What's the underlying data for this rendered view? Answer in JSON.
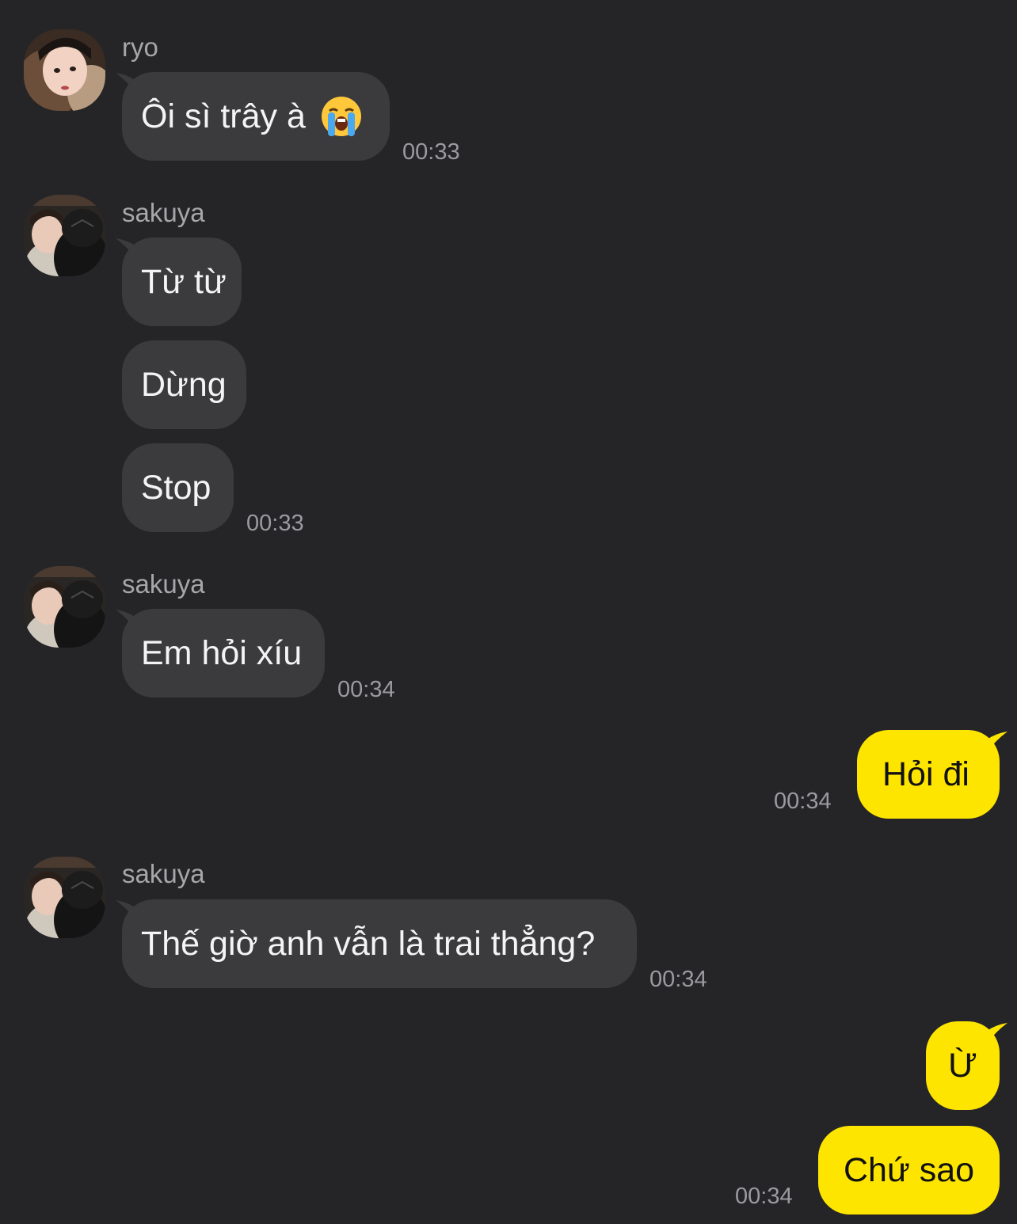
{
  "colors": {
    "background": "#252528",
    "incoming_bubble": "#3b3b3e",
    "outgoing_bubble": "#fee500",
    "timestamp": "#9b9b9f",
    "sender_name": "#a7a7aa"
  },
  "messages": {
    "g1": {
      "sender": "ryo",
      "text": "Ôi sì trây à",
      "emoji": "loudly-crying-face-icon",
      "time": "00:33"
    },
    "g2": {
      "sender": "sakuya",
      "texts": [
        "Từ từ",
        "Dừng",
        "Stop"
      ],
      "time": "00:33"
    },
    "g3": {
      "sender": "sakuya",
      "text": "Em hỏi xíu",
      "time": "00:34"
    },
    "g4": {
      "text": "Hỏi đi",
      "time": "00:34"
    },
    "g5": {
      "sender": "sakuya",
      "text": "Thế giờ anh vẫn là trai thẳng?",
      "time": "00:34"
    },
    "g6": {
      "texts": [
        "Ừ",
        "Chứ sao"
      ],
      "time": "00:34"
    }
  }
}
